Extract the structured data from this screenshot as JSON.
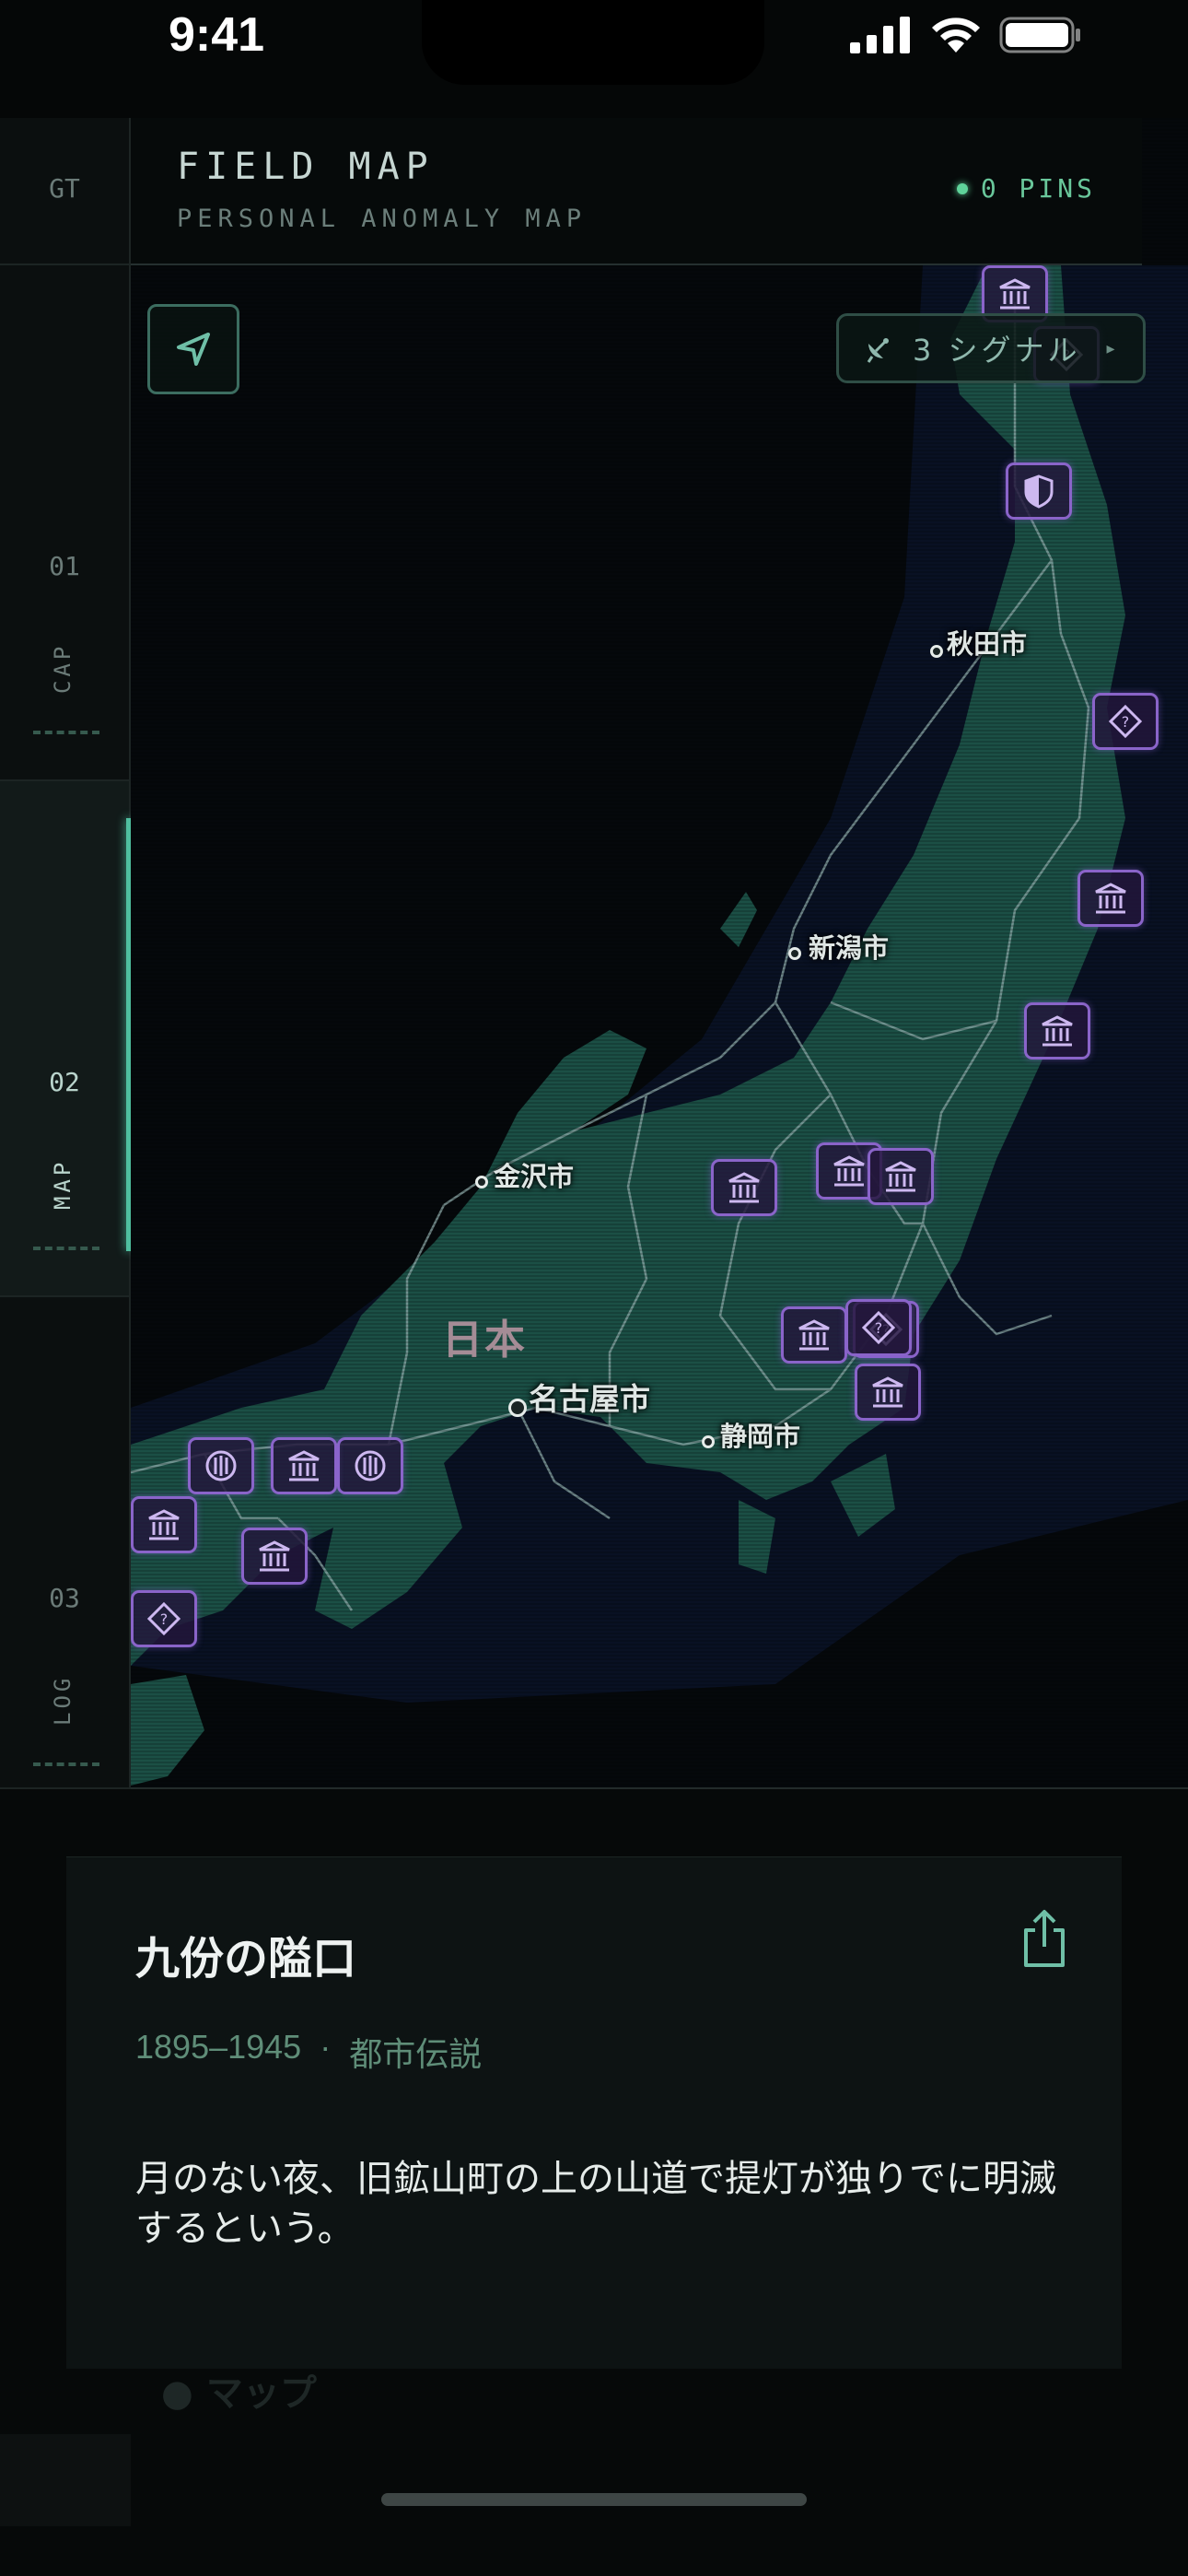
{
  "status_bar": {
    "time": "9:41"
  },
  "header": {
    "title": "FIELD MAP",
    "subtitle": "PERSONAL ANOMALY MAP",
    "pins_status": "0 PINS"
  },
  "rail": {
    "top_label": "GT",
    "tabs": [
      {
        "num": "01",
        "label": "CAP",
        "active": false
      },
      {
        "num": "02",
        "label": "MAP",
        "active": true
      },
      {
        "num": "03",
        "label": "LOG",
        "active": false
      }
    ]
  },
  "map": {
    "signal_button": {
      "label": "3 シグナル",
      "arrow": "▸",
      "icon": "satellite-icon"
    },
    "locate_icon": "location-arrow-icon",
    "country": "日本",
    "cities": [
      {
        "name": "秋田市"
      },
      {
        "name": "新潟市"
      },
      {
        "name": "金沢市"
      },
      {
        "name": "名古屋市"
      },
      {
        "name": "静岡市"
      }
    ],
    "pin_types": {
      "museum": "museum-icon",
      "unknown": "question-icon",
      "shield": "shield-icon",
      "grid": "grid-globe-icon"
    },
    "attribution": "マップ"
  },
  "card": {
    "title": "九份の隘口",
    "years": "1895–1945",
    "separator": "·",
    "category": "都市伝説",
    "description": "月のない夜、旧鉱山町の上の山道で提灯が独りでに明滅するという。",
    "share_icon": "share-icon"
  },
  "colors": {
    "accent": "#4fbf9f",
    "pin": "#8a64c9",
    "land": "#1b4f45",
    "sea": "#06090c"
  }
}
